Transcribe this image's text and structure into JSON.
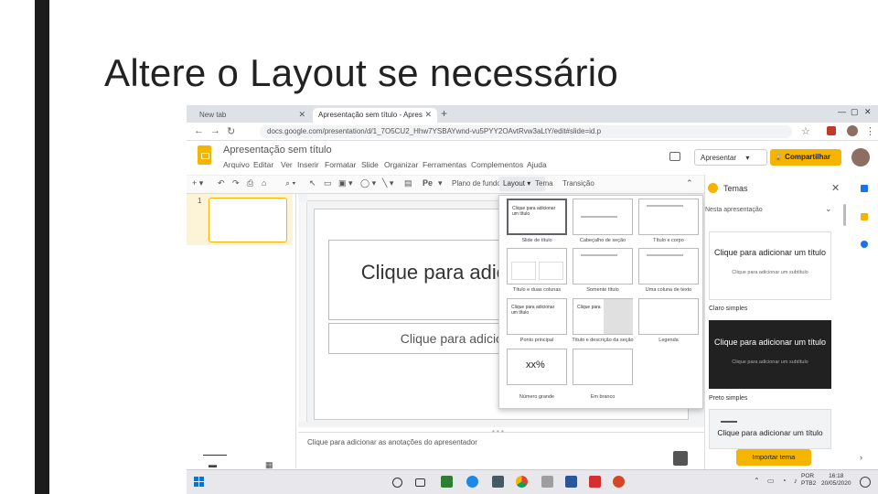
{
  "slide": {
    "title": "Altere o Layout se necessário"
  },
  "browser": {
    "tabs": [
      {
        "label": "New tab"
      },
      {
        "label": "Apresentação sem título - Apres"
      }
    ],
    "new_tab_glyph": "+",
    "url": "docs.google.com/presentation/d/1_7O5CU2_Hhw7YSBAYwnd-vu5PYY2OAvtRvw3aLtY/edit#slide=id.p",
    "window_controls": [
      "—",
      "▢",
      "✕"
    ]
  },
  "app": {
    "doc_title": "Apresentação sem título",
    "menus": [
      "Arquivo",
      "Editar",
      "Ver",
      "Inserir",
      "Formatar",
      "Slide",
      "Organizar",
      "Ferramentas",
      "Complementos",
      "Ajuda"
    ],
    "present_label": "Apresentar",
    "share_label": "🔒 Compartilhar",
    "toolbar": {
      "background_label": "Plano de fundo",
      "layout_label": "Layout ▾",
      "theme_label": "Tema",
      "transition_label": "Transição"
    }
  },
  "filmstrip": {
    "slide_number": "1"
  },
  "canvas": {
    "title_placeholder": "Clique para adicionar um título",
    "subtitle_placeholder": "Clique para adicionar um subtítulo",
    "notes_placeholder": "Clique para adicionar as anotações do apresentador"
  },
  "layout_menu": {
    "items": [
      {
        "name": "Slide de título",
        "preview": "Clique para adicionar um título"
      },
      {
        "name": "Cabeçalho de seção",
        "preview": ""
      },
      {
        "name": "Título e corpo",
        "preview": ""
      },
      {
        "name": "Título e duas colunas",
        "preview": ""
      },
      {
        "name": "Somente título",
        "preview": ""
      },
      {
        "name": "Uma coluna de texto",
        "preview": ""
      },
      {
        "name": "Ponto principal",
        "preview": "Clique para adicionar um título"
      },
      {
        "name": "Título e descrição da seção",
        "preview": "Clique para"
      },
      {
        "name": "Legenda",
        "preview": ""
      },
      {
        "name": "Número grande",
        "preview": "xx%"
      },
      {
        "name": "Em branco",
        "preview": ""
      }
    ]
  },
  "themes_panel": {
    "title": "Temas",
    "section": "Nesta apresentação",
    "cards": [
      {
        "title": "Clique para adicionar um título",
        "subtitle": "Clique para adicionar um subtítulo",
        "name": "Claro simples"
      },
      {
        "title": "Clique para adicionar um título",
        "subtitle": "Clique para adicionar um subtítulo",
        "name": "Preto simples"
      },
      {
        "title": "Clique para adicionar um título",
        "subtitle": "",
        "name": ""
      }
    ],
    "import_label": "Importar tema"
  },
  "taskbar": {
    "clock_time": "16:18",
    "clock_date": "20/05/2020",
    "lang": "POR PTB2"
  },
  "colors": {
    "accent": "#f4b400",
    "dark_theme": "#212121",
    "windows_blue": "#0078d7"
  },
  "icons": [
    "back-arrow-icon",
    "forward-arrow-icon",
    "refresh-icon",
    "star-icon",
    "slides-logo-icon",
    "comment-icon",
    "themes-palette-icon",
    "close-icon",
    "chevron-down-icon",
    "windows-start-icon",
    "search-icon",
    "chrome-icon",
    "edge-icon",
    "word-icon",
    "pdf-icon",
    "powerpoint-icon"
  ]
}
